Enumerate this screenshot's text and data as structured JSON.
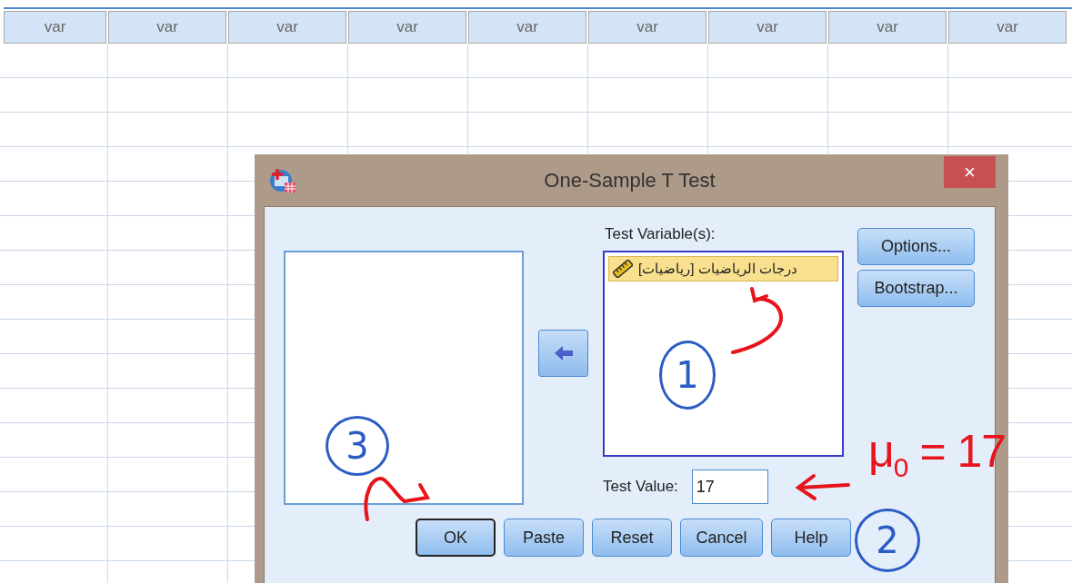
{
  "grid": {
    "columns": [
      "var",
      "var",
      "var",
      "var",
      "var",
      "var",
      "var",
      "var",
      "var"
    ]
  },
  "dialog": {
    "title": "One-Sample T Test",
    "close": "×",
    "test_variables": {
      "label": "Test Variable(s):",
      "items": [
        {
          "text": "درجات الرياضيات [رياضيات]",
          "selected": true
        }
      ]
    },
    "side_buttons": [
      "Options...",
      "Bootstrap..."
    ],
    "test_value": {
      "label": "Test Value:",
      "value": "17"
    },
    "buttons": [
      {
        "label": "OK",
        "default": true
      },
      {
        "label": "Paste",
        "default": false
      },
      {
        "label": "Reset",
        "default": false
      },
      {
        "label": "Cancel",
        "default": false
      },
      {
        "label": "Help",
        "default": false
      }
    ]
  },
  "annotations": [
    {
      "kind": "circled",
      "text": "1",
      "color": "#2a5cc4"
    },
    {
      "kind": "circled",
      "text": "2",
      "color": "#2a5cc4"
    },
    {
      "kind": "circled",
      "text": "3",
      "color": "#2a5cc4"
    },
    {
      "kind": "formula",
      "text": "μ$_{0}$ = 17",
      "color": "#e8141c"
    }
  ]
}
